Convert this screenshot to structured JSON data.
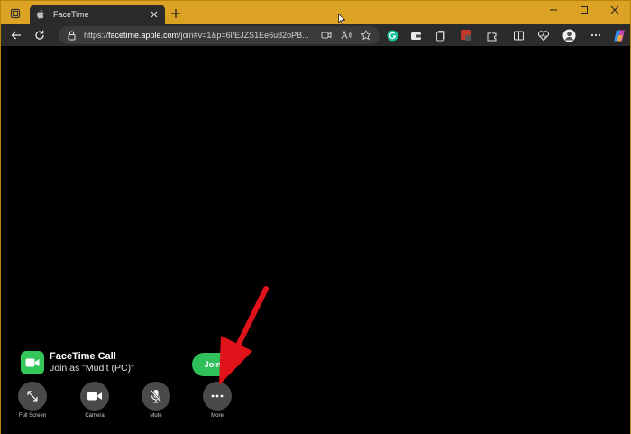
{
  "browser": {
    "tab_title": "FaceTime",
    "url_prefix": "https://",
    "url_domain": "facetime.apple.com",
    "url_rest": "/join#v=1&p=6l/EJZS1Ee6u82oPB..."
  },
  "call": {
    "title": "FaceTime Call",
    "subtitle": "Join as \"Mudit (PC)\"",
    "join_label": "Join"
  },
  "controls": [
    {
      "label": "Full Screen"
    },
    {
      "label": "Camera"
    },
    {
      "label": "Mute"
    },
    {
      "label": "More"
    }
  ],
  "colors": {
    "title_bar": "#dba224",
    "facetime_green": "#34c759",
    "join_green": "#30c05a",
    "arrow_red": "#e0121a"
  }
}
